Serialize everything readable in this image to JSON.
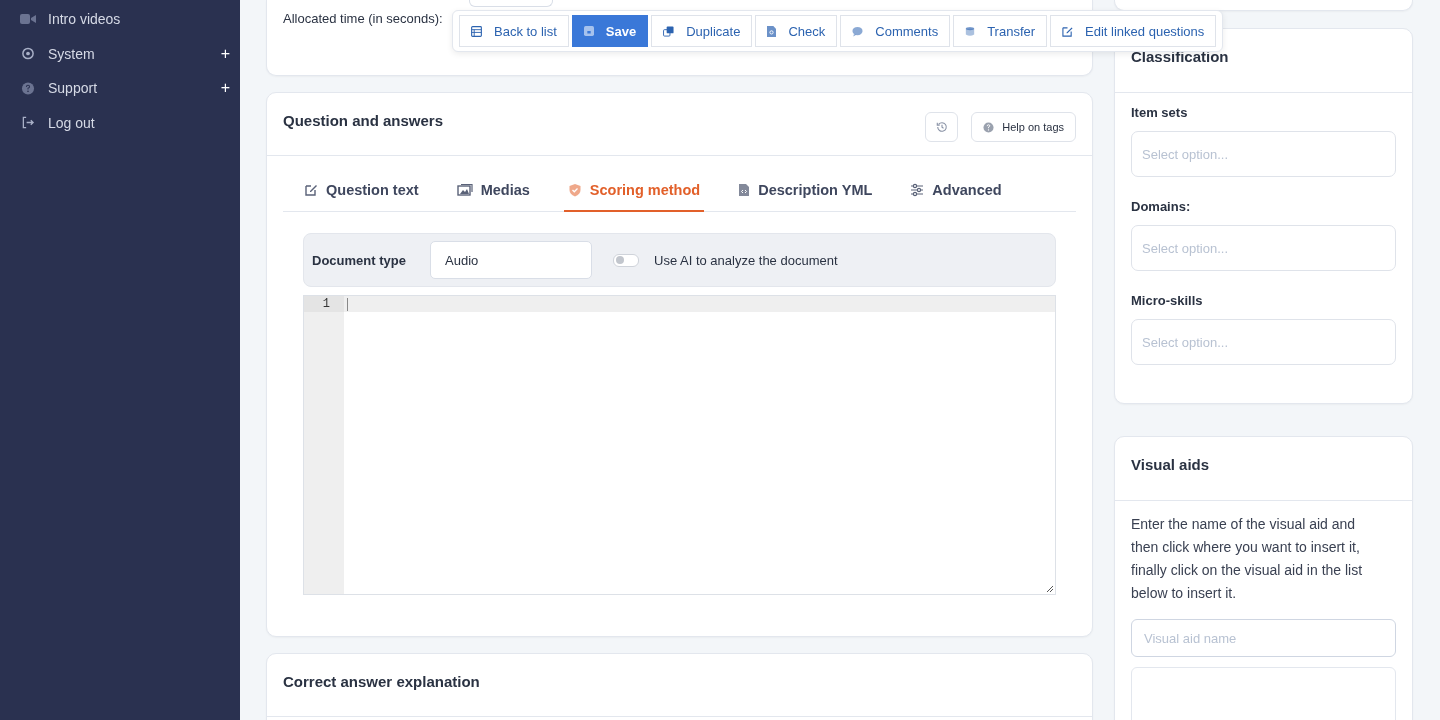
{
  "sidebar": {
    "items": [
      {
        "label": "Intro videos"
      },
      {
        "label": "System",
        "toggle": "+"
      },
      {
        "label": "Support",
        "toggle": "+"
      },
      {
        "label": "Log out"
      }
    ]
  },
  "top_section": {
    "field_label": "Allocated time (in seconds):"
  },
  "toolbar": {
    "buttons": [
      {
        "label": "Back to list",
        "kind": "default"
      },
      {
        "label": "Save",
        "kind": "primary"
      },
      {
        "label": "Duplicate",
        "kind": "default"
      },
      {
        "label": "Check",
        "kind": "default"
      },
      {
        "label": "Comments",
        "kind": "default"
      },
      {
        "label": "Transfer",
        "kind": "default"
      },
      {
        "label": "Edit linked questions",
        "kind": "default"
      }
    ]
  },
  "question_card": {
    "title": "Question and answers",
    "help_button": "Help on tags",
    "tabs": [
      {
        "label": "Question text",
        "selected": false
      },
      {
        "label": "Medias",
        "selected": false
      },
      {
        "label": "Scoring method",
        "selected": true
      },
      {
        "label": "Description YML",
        "selected": false
      },
      {
        "label": "Advanced",
        "selected": false
      }
    ],
    "document_type": {
      "label": "Document type",
      "value": "Audio"
    },
    "ai_toggle": {
      "label": "Use AI to analyze the document",
      "on": false
    },
    "editor": {
      "line_numbers": [
        "1"
      ]
    }
  },
  "explanation_card": {
    "title": "Correct answer explanation"
  },
  "classification": {
    "title": "Classification",
    "fields": [
      {
        "label": "Item sets",
        "placeholder": "Select option..."
      },
      {
        "label": "Domains:",
        "placeholder": "Select option..."
      },
      {
        "label": "Micro-skills",
        "placeholder": "Select option..."
      }
    ]
  },
  "visual_aids": {
    "title": "Visual aids",
    "instructions": "Enter the name of the visual aid and then click where you want to insert it, finally click on the visual aid in the list below to insert it.",
    "name_placeholder": "Visual aid name"
  }
}
